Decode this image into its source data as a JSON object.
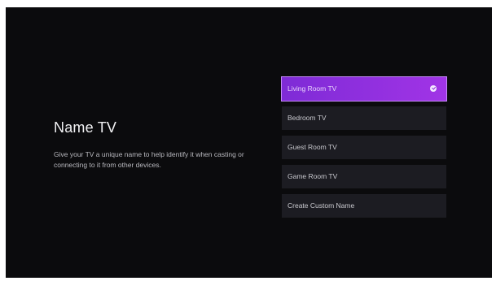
{
  "page": {
    "title": "Name TV",
    "description": "Give your TV a unique name to help identify it when casting or connecting to it from other devices."
  },
  "options": [
    {
      "label": "Living Room TV",
      "selected": true
    },
    {
      "label": "Bedroom TV",
      "selected": false
    },
    {
      "label": "Guest Room TV",
      "selected": false
    },
    {
      "label": "Game Room TV",
      "selected": false
    },
    {
      "label": "Create Custom Name",
      "selected": false
    }
  ],
  "icons": {
    "selected_indicator": "check-circle-icon"
  },
  "colors": {
    "background": "#0b0b0d",
    "option_background": "#1c1c22",
    "accent_start": "#7e2bd6",
    "accent_end": "#a134e6"
  }
}
